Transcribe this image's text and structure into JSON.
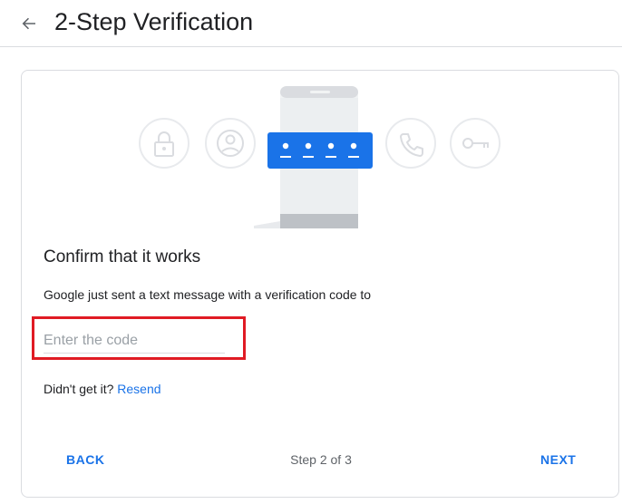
{
  "header": {
    "title": "2-Step Verification",
    "back_icon": "arrow-back-icon"
  },
  "illustration": {
    "icons": [
      "lock-icon",
      "account-icon",
      "phone-icon",
      "key-icon"
    ],
    "code_dots": 4,
    "accent_color": "#1a73e8"
  },
  "main": {
    "heading": "Confirm that it works",
    "message": "Google just sent a text message with a verification code to",
    "code_input": {
      "placeholder": "Enter the code",
      "value": ""
    },
    "resend": {
      "prompt": "Didn't get it?",
      "link": "Resend"
    }
  },
  "footer": {
    "back_label": "BACK",
    "step": "Step 2 of 3",
    "next_label": "NEXT"
  },
  "colors": {
    "link": "#1a73e8",
    "highlight_box": "#e01b24",
    "border": "#dadce0"
  }
}
